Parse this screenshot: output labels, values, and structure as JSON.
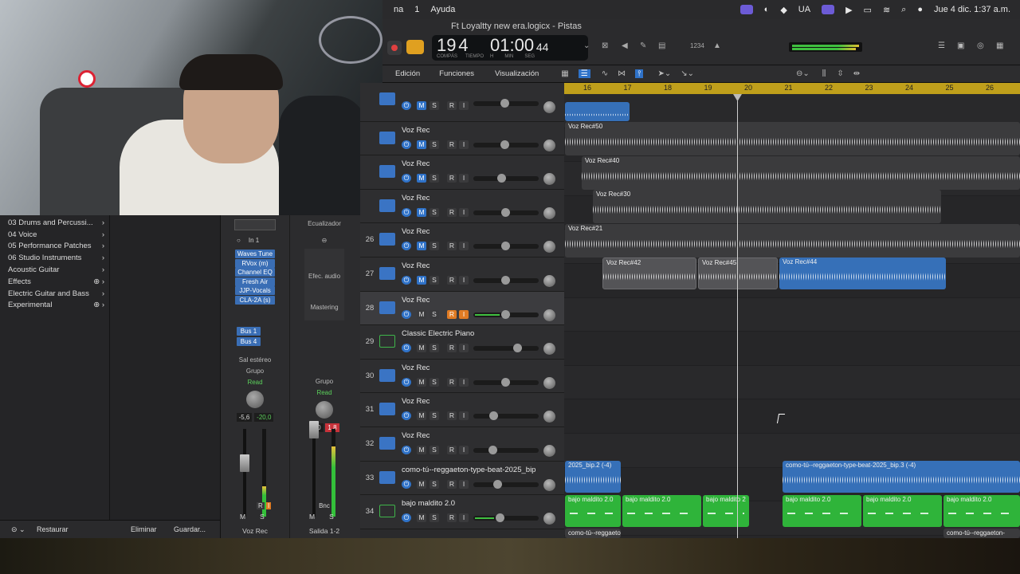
{
  "menubar": {
    "items": [
      "na",
      "1",
      "Ayuda"
    ],
    "status": [
      "UA"
    ],
    "datetime": "Jue 4 dic.  1:37 a.m."
  },
  "titlebar": {
    "doc_title": "Ft Loyaltty new era.logicx - Pistas",
    "lcd": {
      "bar": "19",
      "beat": "4",
      "bar_label": "COMPÁS",
      "beat_label": "TIEMPO",
      "time": "01:00",
      "time_small": "44",
      "h_label": "H",
      "min_label": "MIN",
      "sec_label": "SEG"
    },
    "key_display": "1234"
  },
  "library": {
    "items": [
      {
        "label": "03 Drums and Percussi...",
        "icon": "chevron-right-icon"
      },
      {
        "label": "04 Voice",
        "icon": "chevron-right-icon"
      },
      {
        "label": "05 Performance Patches",
        "icon": "chevron-right-icon"
      },
      {
        "label": "06 Studio Instruments",
        "icon": "chevron-right-icon"
      },
      {
        "label": "Acoustic Guitar",
        "icon": "chevron-right-icon"
      },
      {
        "label": "Effects",
        "icon": "download-icon"
      },
      {
        "label": "Electric Guitar and Bass",
        "icon": "chevron-right-icon"
      },
      {
        "label": "Experimental",
        "icon": "download-icon"
      }
    ],
    "restore": "Restaurar",
    "delete": "Eliminar",
    "save": "Guardar..."
  },
  "strip1": {
    "input": "In 1",
    "plugins": [
      "Waves Tune",
      "RVox (m)",
      "Channel EQ",
      "Fresh Air",
      "JJP-Vocals",
      "CLA-2A (s)"
    ],
    "sends": [
      "Bus 1",
      "Bus 4"
    ],
    "output": "Sal estéreo",
    "group": "Grupo",
    "automation": "Read",
    "vol": "-5,6",
    "peak": "-20,0",
    "name": "Voz Rec",
    "r": "R",
    "i": "I",
    "m": "M",
    "s": "S"
  },
  "strip2": {
    "eq": "Ecualizador",
    "fx": "Efec. audio",
    "mastering": "Mastering",
    "group": "Grupo",
    "automation": "Read",
    "vol": "6,0",
    "peak": "1,8",
    "bnc": "Bnc",
    "name": "Salida 1-2",
    "m": "M",
    "s": "S"
  },
  "toolbar": {
    "edit": "Edición",
    "functions": "Funciones",
    "view": "Visualización",
    "s": "S"
  },
  "ruler": [
    "16",
    "17",
    "18",
    "19",
    "20",
    "21",
    "22",
    "23",
    "24",
    "25",
    "26"
  ],
  "tracks": [
    {
      "num": "",
      "name": "",
      "type": "audio"
    },
    {
      "num": "",
      "name": "Voz Rec",
      "type": "audio"
    },
    {
      "num": "",
      "name": "Voz Rec",
      "type": "audio"
    },
    {
      "num": "",
      "name": "Voz Rec",
      "type": "audio"
    },
    {
      "num": "26",
      "name": "Voz Rec",
      "type": "audio"
    },
    {
      "num": "27",
      "name": "Voz Rec",
      "type": "audio"
    },
    {
      "num": "28",
      "name": "Voz Rec",
      "type": "audio",
      "selected": true
    },
    {
      "num": "29",
      "name": "Classic Electric Piano",
      "type": "instrument"
    },
    {
      "num": "30",
      "name": "Voz Rec",
      "type": "audio"
    },
    {
      "num": "31",
      "name": "Voz Rec",
      "type": "audio"
    },
    {
      "num": "32",
      "name": "Voz Rec",
      "type": "audio"
    },
    {
      "num": "33",
      "name": "como-tú--reggaeton-type-beat-2025_bip",
      "type": "audio"
    },
    {
      "num": "34",
      "name": "bajo maldito 2.0",
      "type": "instrument"
    }
  ],
  "track_buttons": {
    "m": "M",
    "s": "S",
    "r": "R",
    "i": "I"
  },
  "regions": [
    {
      "label": "Voz Rec#50"
    },
    {
      "label": "Voz Rec#40"
    },
    {
      "label": "Voz Rec#30"
    },
    {
      "label": "Voz Rec#21"
    },
    {
      "label": "Voz Rec#42"
    },
    {
      "label": "Voz Rec#45"
    },
    {
      "label": "Voz Rec#44"
    },
    {
      "label": "2025_bip.2 (-4)"
    },
    {
      "label": "como-tú--reggaeton-type-beat-2025_bip.3 (-4)"
    },
    {
      "label": "bajo maldito 2.0"
    },
    {
      "label": "bajo maldito 2.0"
    },
    {
      "label": "bajo maldito 2"
    },
    {
      "label": "bajo maldito 2.0"
    },
    {
      "label": "bajo maldito 2.0"
    },
    {
      "label": "bajo maldito 2.0"
    },
    {
      "label": "como-tú--reggaeton-"
    },
    {
      "label": "como-tú--reggaeton-"
    }
  ],
  "colors": {
    "accent": "#2f72c8",
    "record": "#e04040",
    "cycle": "#e0a020",
    "ruler": "#c7a51a",
    "audio_region": "#3670b8",
    "midi_region": "#2fb43a"
  }
}
